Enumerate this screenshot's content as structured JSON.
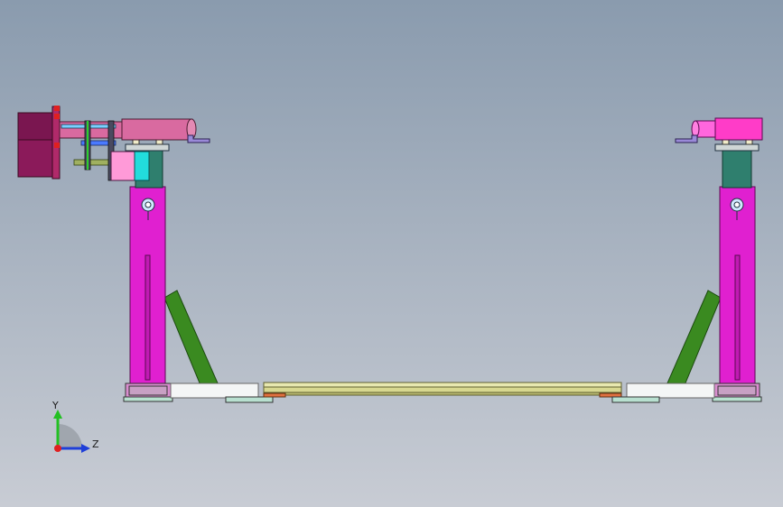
{
  "viewport": {
    "colors": {
      "background_top": "#8a9bae",
      "background_bottom": "#c8ccd4",
      "magenta": "#e020d0",
      "green": "#3a8a20",
      "teal": "#2f7f6e",
      "pink_tube": "#d96aa0",
      "hot_pink": "#ff3cc8",
      "maroon": "#8b1a5a",
      "light_gray": "#d9dde0",
      "olive_beam": "#d8d890"
    }
  },
  "triad": {
    "y_label": "Y",
    "z_label": "Z",
    "y_color": "#22c022",
    "z_color": "#1f3fd8",
    "origin_color": "#e02020"
  }
}
